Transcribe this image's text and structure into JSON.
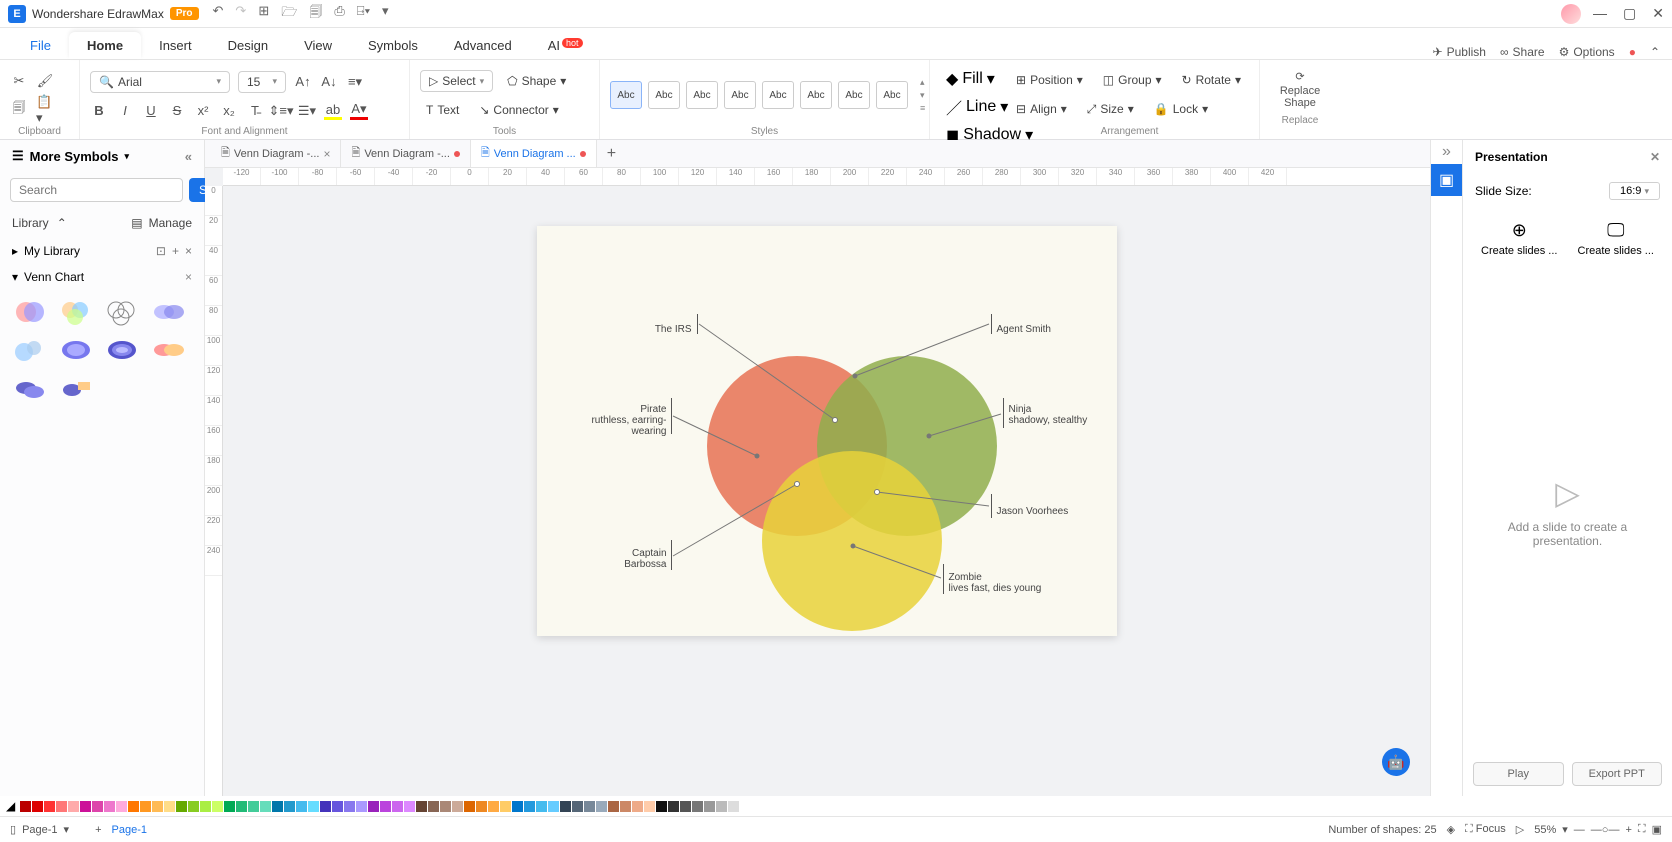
{
  "titlebar": {
    "app_name": "Wondershare EdrawMax",
    "badge": "Pro"
  },
  "menu": {
    "tabs": [
      "File",
      "Home",
      "Insert",
      "Design",
      "View",
      "Symbols",
      "Advanced",
      "AI"
    ],
    "active": "Home",
    "hot_label": "hot",
    "right": {
      "publish": "Publish",
      "share": "Share",
      "options": "Options"
    }
  },
  "ribbon": {
    "clipboard": "Clipboard",
    "font_name": "Arial",
    "font_size": "15",
    "font_align": "Font and Alignment",
    "select": "Select",
    "text": "Text",
    "shape": "Shape",
    "connector": "Connector",
    "tools": "Tools",
    "styles": "Styles",
    "style_label": "Abc",
    "fill": "Fill",
    "line": "Line",
    "shadow": "Shadow",
    "position": "Position",
    "align": "Align",
    "group": "Group",
    "size": "Size",
    "rotate": "Rotate",
    "lock": "Lock",
    "arrangement": "Arrangement",
    "replace_shape": "Replace\nShape",
    "replace": "Replace"
  },
  "left": {
    "header": "More Symbols",
    "search_placeholder": "Search",
    "search_btn": "Search",
    "library": "Library",
    "manage": "Manage",
    "mylib": "My Library",
    "category": "Venn Chart"
  },
  "doctabs": [
    {
      "label": "Venn Diagram -...",
      "modified": false,
      "active": false
    },
    {
      "label": "Venn Diagram -...",
      "modified": true,
      "active": false
    },
    {
      "label": "Venn Diagram ...",
      "modified": true,
      "active": true
    }
  ],
  "ruler_h": [
    "-120",
    "-100",
    "-80",
    "-60",
    "-40",
    "-20",
    "0",
    "20",
    "40",
    "60",
    "80",
    "100",
    "120",
    "140",
    "160",
    "180",
    "200",
    "220",
    "240",
    "260",
    "280",
    "300",
    "320",
    "340",
    "360",
    "380",
    "400",
    "420"
  ],
  "ruler_v": [
    "0",
    "20",
    "40",
    "60",
    "80",
    "100",
    "120",
    "140",
    "160",
    "180",
    "200",
    "220",
    "240"
  ],
  "diagram": {
    "labels": {
      "irs": "The IRS",
      "agent": "Agent Smith",
      "pirate": "Pirate\nruthless, earring-\nwearing",
      "ninja": "Ninja\nshadowy, stealthy",
      "captain": "Captain\nBarbossa",
      "jason": "Jason Voorhees",
      "zombie": "Zombie\nlives fast, dies young"
    }
  },
  "right": {
    "header": "Presentation",
    "slide_size_label": "Slide Size:",
    "slide_size_value": "16:9",
    "create1": "Create slides ...",
    "create2": "Create slides ...",
    "empty": "Add a slide to create a\npresentation.",
    "play": "Play",
    "export": "Export PPT"
  },
  "palette": [
    "#c00",
    "#e00",
    "#f44",
    "#f88",
    "#d19",
    "#e4a",
    "#f7c",
    "#fad",
    "#fa0",
    "#fb3",
    "#fc6",
    "#fd9",
    "#8c0",
    "#9d2",
    "#ae4",
    "#bf6",
    "#0a8",
    "#2b9",
    "#4ca",
    "#6db",
    "#08d",
    "#29e",
    "#4af",
    "#6bf",
    "#43c",
    "#65d",
    "#87e",
    "#a9f",
    "#a2c",
    "#b4d",
    "#c6e",
    "#d8f",
    "#753",
    "#975",
    "#b97",
    "#db9",
    "#222",
    "#555",
    "#888",
    "#bbb",
    "#fff"
  ],
  "statusbar": {
    "page_sel": "Page-1",
    "page_name": "Page-1",
    "shape_count": "Number of shapes: 25",
    "focus": "Focus",
    "zoom": "55%"
  },
  "chart_data": {
    "type": "venn",
    "title": "",
    "sets": [
      {
        "name": "Pirate",
        "desc": "ruthless, earring-wearing",
        "color": "#e67253"
      },
      {
        "name": "Ninja",
        "desc": "shadowy, stealthy",
        "color": "#8fae4c"
      },
      {
        "name": "Zombie",
        "desc": "lives fast, dies young",
        "color": "#e8d239"
      }
    ],
    "intersections": [
      {
        "sets": [
          "Pirate",
          "Ninja"
        ],
        "label": "Agent Smith"
      },
      {
        "sets": [
          "Pirate",
          "Zombie"
        ],
        "label": "Captain Barbossa"
      },
      {
        "sets": [
          "Ninja",
          "Zombie"
        ],
        "label": "Jason Voorhees"
      },
      {
        "sets": [
          "Pirate",
          "Ninja",
          "Zombie"
        ],
        "label": "The IRS"
      }
    ]
  }
}
